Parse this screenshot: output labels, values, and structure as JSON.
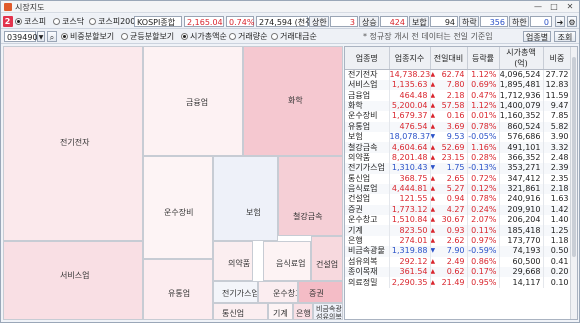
{
  "window": {
    "title": "시장지도",
    "min": "—",
    "max": "□",
    "close": "✕"
  },
  "badges": {
    "one": "1",
    "two": "2"
  },
  "market_tabs": [
    {
      "label": "코스피",
      "selected": true
    },
    {
      "label": "코스닥",
      "selected": false
    },
    {
      "label": "코스피200",
      "selected": false
    }
  ],
  "index": {
    "name": "KOSPI종합",
    "value": "2,165.04",
    "change": "0.74%",
    "volume": "274,594 (천주)"
  },
  "breadth": {
    "upper_label": "상한",
    "upper": "3",
    "rise_label": "상승",
    "rise": "424",
    "flat_label": "보합",
    "flat": "94",
    "fall_label": "하락",
    "fall": "356",
    "lower_label": "하한",
    "lower": "0"
  },
  "toolbar2": {
    "code": "039490",
    "view_options": [
      {
        "label": "비중분할보기",
        "selected": true
      },
      {
        "label": "균등분할보기",
        "selected": false
      }
    ],
    "metric_options": [
      {
        "label": "시가총액순",
        "selected": true
      },
      {
        "label": "거래량순",
        "selected": false
      },
      {
        "label": "거래대금순",
        "selected": false
      }
    ],
    "notice": "* 정규장 개시 전 데이터는 전일 기준임",
    "sector_btn": "업종별",
    "query_btn": "조회"
  },
  "treemap": {
    "sectors": [
      {
        "name": "전기전자"
      },
      {
        "name": "금융업"
      },
      {
        "name": "화학"
      },
      {
        "name": "운수장비"
      },
      {
        "name": "보험"
      },
      {
        "name": "철강금속"
      },
      {
        "name": "서비스업"
      },
      {
        "name": "의약품"
      },
      {
        "name": "음식료업"
      },
      {
        "name": "건설업"
      },
      {
        "name": "유통업"
      },
      {
        "name": "전기가스업"
      },
      {
        "name": "증권"
      },
      {
        "name": "운수창고"
      },
      {
        "name": "통신업"
      },
      {
        "name": "기계"
      },
      {
        "name": "은행"
      },
      {
        "name": "비금속광물"
      },
      {
        "name": "섬유의복"
      },
      {
        "name": "종이목재"
      }
    ]
  },
  "table": {
    "headers": [
      "업종명",
      "업종지수",
      "전일대비",
      "등락률",
      "시가총액(억)",
      "비중"
    ],
    "rows": [
      {
        "name": "전기전자",
        "index": "14,738.23",
        "dir": "up",
        "diff": "62.74",
        "rate": "1.12%",
        "cap": "4,096,524",
        "weight": "27.72"
      },
      {
        "name": "서비스업",
        "index": "1,135.63",
        "dir": "up",
        "diff": "7.80",
        "rate": "0.69%",
        "cap": "1,895,481",
        "weight": "12.83"
      },
      {
        "name": "금융업",
        "index": "464.48",
        "dir": "up",
        "diff": "2.18",
        "rate": "0.47%",
        "cap": "1,712,936",
        "weight": "11.59"
      },
      {
        "name": "화학",
        "index": "5,200.04",
        "dir": "up",
        "diff": "57.58",
        "rate": "1.12%",
        "cap": "1,400,079",
        "weight": "9.47"
      },
      {
        "name": "운수장비",
        "index": "1,679.37",
        "dir": "up",
        "diff": "0.16",
        "rate": "0.01%",
        "cap": "1,160,352",
        "weight": "7.85"
      },
      {
        "name": "유통업",
        "index": "476.54",
        "dir": "up",
        "diff": "3.69",
        "rate": "0.78%",
        "cap": "860,524",
        "weight": "5.82"
      },
      {
        "name": "보험",
        "index": "18,078.37",
        "dir": "down",
        "diff": "9.53",
        "rate": "-0.05%",
        "cap": "576,686",
        "weight": "3.90"
      },
      {
        "name": "철강금속",
        "index": "4,604.64",
        "dir": "up",
        "diff": "52.69",
        "rate": "1.16%",
        "cap": "491,101",
        "weight": "3.32"
      },
      {
        "name": "의약품",
        "index": "8,201.48",
        "dir": "up",
        "diff": "23.15",
        "rate": "0.28%",
        "cap": "366,352",
        "weight": "2.48"
      },
      {
        "name": "전기가스업",
        "index": "1,310.43",
        "dir": "down",
        "diff": "1.75",
        "rate": "-0.13%",
        "cap": "353,271",
        "weight": "2.39"
      },
      {
        "name": "통신업",
        "index": "368.75",
        "dir": "up",
        "diff": "2.65",
        "rate": "0.72%",
        "cap": "347,412",
        "weight": "2.35"
      },
      {
        "name": "음식료업",
        "index": "4,444.81",
        "dir": "up",
        "diff": "5.27",
        "rate": "0.12%",
        "cap": "321,861",
        "weight": "2.18"
      },
      {
        "name": "건설업",
        "index": "121.55",
        "dir": "up",
        "diff": "0.94",
        "rate": "0.78%",
        "cap": "240,916",
        "weight": "1.63"
      },
      {
        "name": "증권",
        "index": "1,773.12",
        "dir": "up",
        "diff": "4.27",
        "rate": "0.24%",
        "cap": "209,910",
        "weight": "1.42"
      },
      {
        "name": "운수창고",
        "index": "1,510.84",
        "dir": "up",
        "diff": "30.67",
        "rate": "2.07%",
        "cap": "206,204",
        "weight": "1.40"
      },
      {
        "name": "기계",
        "index": "823.50",
        "dir": "up",
        "diff": "0.93",
        "rate": "0.11%",
        "cap": "185,418",
        "weight": "1.25"
      },
      {
        "name": "은행",
        "index": "274.01",
        "dir": "up",
        "diff": "2.62",
        "rate": "0.97%",
        "cap": "173,770",
        "weight": "1.18"
      },
      {
        "name": "비금속광물",
        "index": "1,319.88",
        "dir": "down",
        "diff": "7.90",
        "rate": "-0.59%",
        "cap": "74,193",
        "weight": "0.50"
      },
      {
        "name": "섬유의복",
        "index": "292.12",
        "dir": "up",
        "diff": "2.49",
        "rate": "0.86%",
        "cap": "60,500",
        "weight": "0.41"
      },
      {
        "name": "종이목재",
        "index": "361.54",
        "dir": "up",
        "diff": "0.62",
        "rate": "0.17%",
        "cap": "29,668",
        "weight": "0.20"
      },
      {
        "name": "의료정밀",
        "index": "2,290.35",
        "dir": "up",
        "diff": "21.49",
        "rate": "0.95%",
        "cap": "14,117",
        "weight": "0.10"
      }
    ]
  }
}
